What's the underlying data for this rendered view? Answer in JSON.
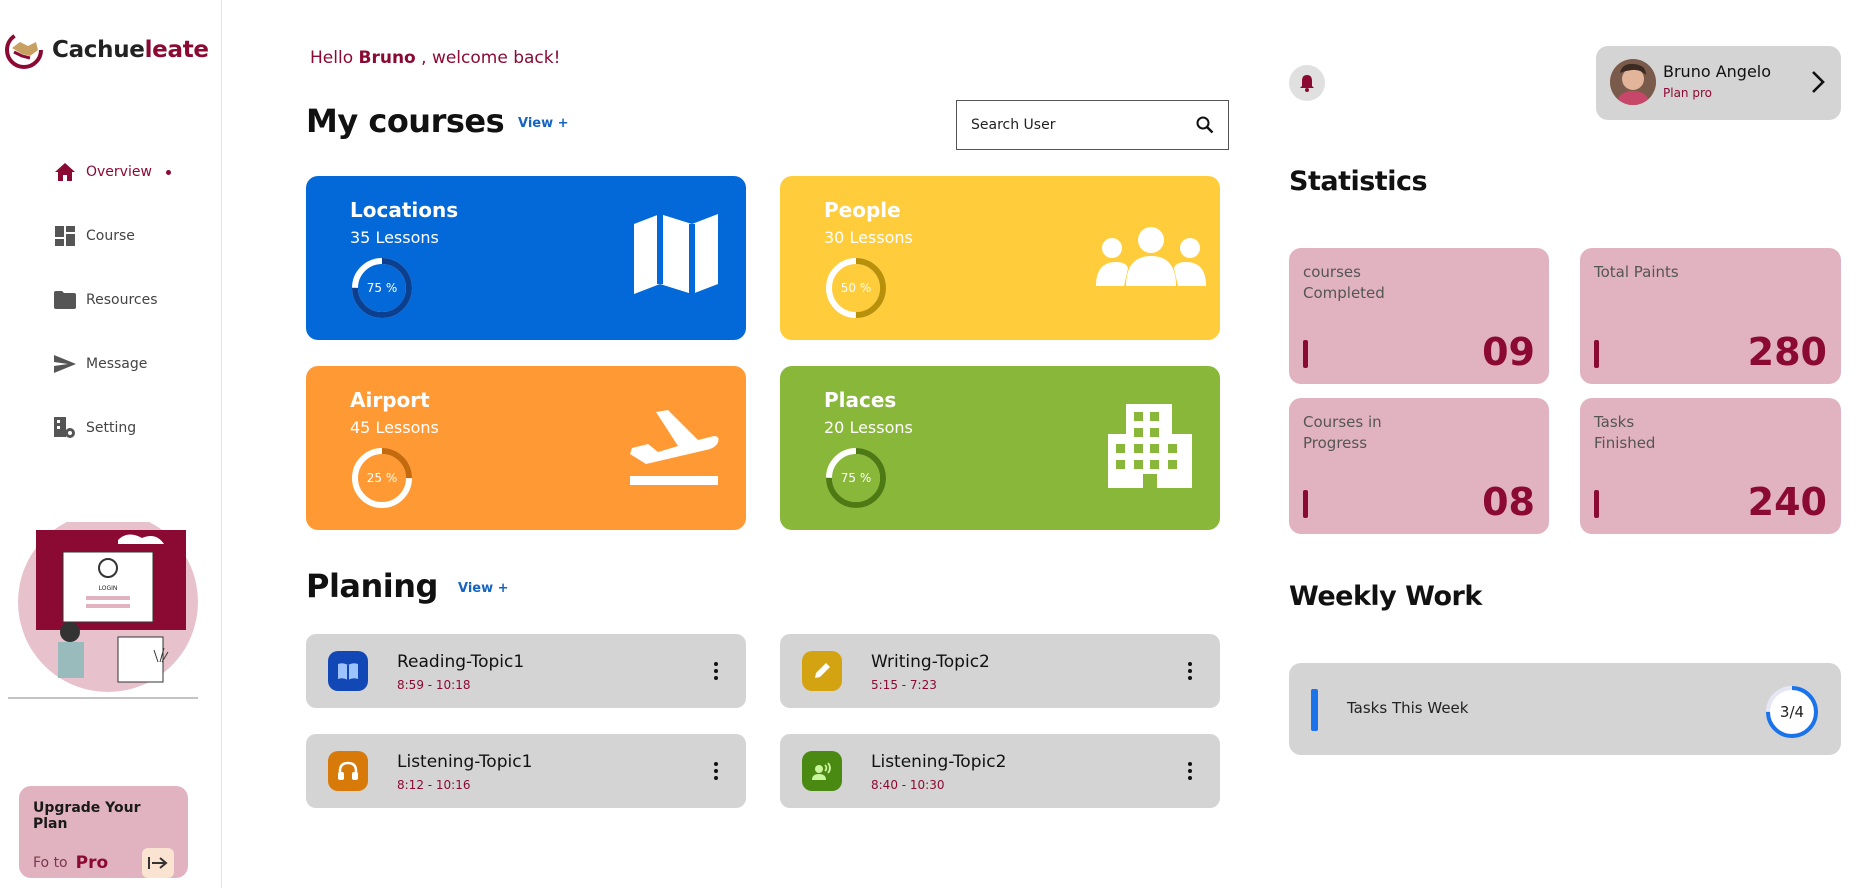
{
  "brand": {
    "name_part1": "Cachue",
    "name_part2": "leate"
  },
  "sidebar": {
    "items": [
      {
        "label": "Overview",
        "icon": "home-icon",
        "active": true
      },
      {
        "label": "Course",
        "icon": "dashboard-icon",
        "active": false
      },
      {
        "label": "Resources",
        "icon": "folder-icon",
        "active": false
      },
      {
        "label": "Message",
        "icon": "send-icon",
        "active": false
      },
      {
        "label": "Setting",
        "icon": "settings-icon",
        "active": false
      }
    ],
    "upgrade": {
      "title": "Upgrade Your Plan",
      "goto": "Fo to",
      "pro": "Pro"
    }
  },
  "illustration": {
    "login_text": "LOGIN"
  },
  "greeting": {
    "hello": "Hello",
    "name": "Bruno",
    "rest": ", welcome back!"
  },
  "courses": {
    "title": "My courses",
    "view_link": "View +",
    "search_placeholder": "Search User",
    "cards": [
      {
        "title": "Locations",
        "lessons": "35 Lessons",
        "progress_label": "75 %",
        "progress": 0.75,
        "color": "#0469d8",
        "icon": "map-icon"
      },
      {
        "title": "People",
        "lessons": "30 Lessons",
        "progress_label": "50 %",
        "progress": 0.5,
        "color": "#ffcc3c",
        "icon": "people-icon"
      },
      {
        "title": "Airport",
        "lessons": "45 Lessons",
        "progress_label": "25 %",
        "progress": 0.25,
        "color": "#ff9933",
        "icon": "airplane-icon"
      },
      {
        "title": "Places",
        "lessons": "20 Lessons",
        "progress_label": "75 %",
        "progress": 0.75,
        "color": "#88b73a",
        "icon": "building-icon"
      }
    ]
  },
  "planning": {
    "title": "Planing",
    "view_link": "View +",
    "items": [
      {
        "title": "Reading-Topic1",
        "time": "8:59 - 10:18",
        "icon": "book-icon",
        "icon_bg": "#1148b5"
      },
      {
        "title": "Writing-Topic2",
        "time": "5:15 - 7:23",
        "icon": "pencil-icon",
        "icon_bg": "#d4a311"
      },
      {
        "title": "Listening-Topic1",
        "time": "8:12 - 10:16",
        "icon": "headphones-icon",
        "icon_bg": "#d87a0a"
      },
      {
        "title": "Listening-Topic2",
        "time": "8:40 - 10:30",
        "icon": "voice-icon",
        "icon_bg": "#4a8a12"
      }
    ]
  },
  "profile": {
    "name": "Bruno Angelo",
    "plan": "Plan pro"
  },
  "statistics": {
    "title": "Statistics",
    "cards": [
      {
        "label": "courses\nCompleted",
        "value": "09"
      },
      {
        "label": "Total Paints",
        "value": "280"
      },
      {
        "label": "Courses in\nProgress",
        "value": "08"
      },
      {
        "label": "Tasks\nFinished",
        "value": "240"
      }
    ]
  },
  "weekly": {
    "title": "Weekly Work",
    "label": "Tasks This Week",
    "fraction": "3/4",
    "progress": 0.75
  },
  "colors": {
    "accent": "#8b0a33",
    "stat_bg": "#e1b3c0",
    "panel_bg": "#d4d4d4"
  }
}
